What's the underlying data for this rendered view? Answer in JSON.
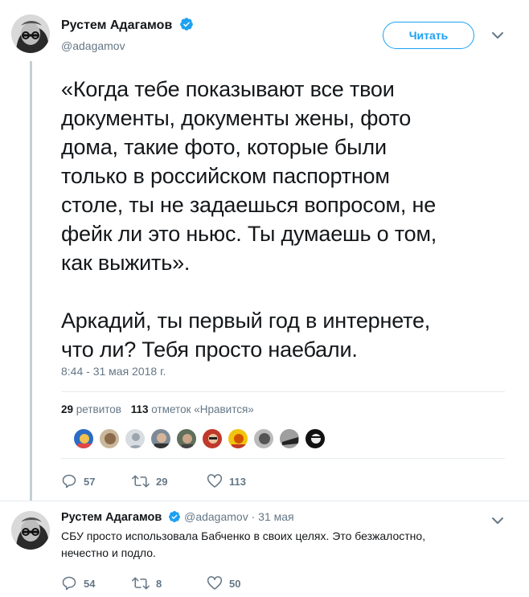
{
  "main_tweet": {
    "author_name": "Рустем Адагамов",
    "author_handle": "@adagamov",
    "follow_label": "Читать",
    "paragraphs": [
      "«Когда тебе показывают все твои\nдокументы, документы жены, фото\nдома, такие фото, которые были\nтолько в российском паспортном\nстоле, ты не задаешься вопросом, не\nфейк ли это ньюс. Ты думаешь о том,\nкак выжить».",
      "Аркадий, ты первый год в интернете,\nчто ли? Тебя просто наебали."
    ],
    "timestamp": "8:44 - 31 мая 2018 г.",
    "retweets_count": "29",
    "retweets_label": "ретвитов",
    "likes_count": "113",
    "likes_label": "отметок «Нравится»",
    "reply_count": "57",
    "retweet_count_action": "29",
    "like_count_action": "113"
  },
  "reply_tweet": {
    "author_name": "Рустем Адагамов",
    "author_handle": "@adagamov",
    "separator": "·",
    "date": "31 мая",
    "text": "СБУ просто использовала Бабченко в своих целях. Это безжалостно,\nнечестно и подло.",
    "reply_count": "54",
    "retweet_count": "8",
    "like_count": "50"
  },
  "colors": {
    "brand": "#1da1f2",
    "text": "#14171a",
    "secondary": "#657786",
    "border": "#e6ecf0",
    "thread": "#c4cfd6"
  },
  "icons": [
    "verified-badge-icon",
    "chevron-down-icon",
    "reply-icon",
    "retweet-icon",
    "heart-icon"
  ]
}
